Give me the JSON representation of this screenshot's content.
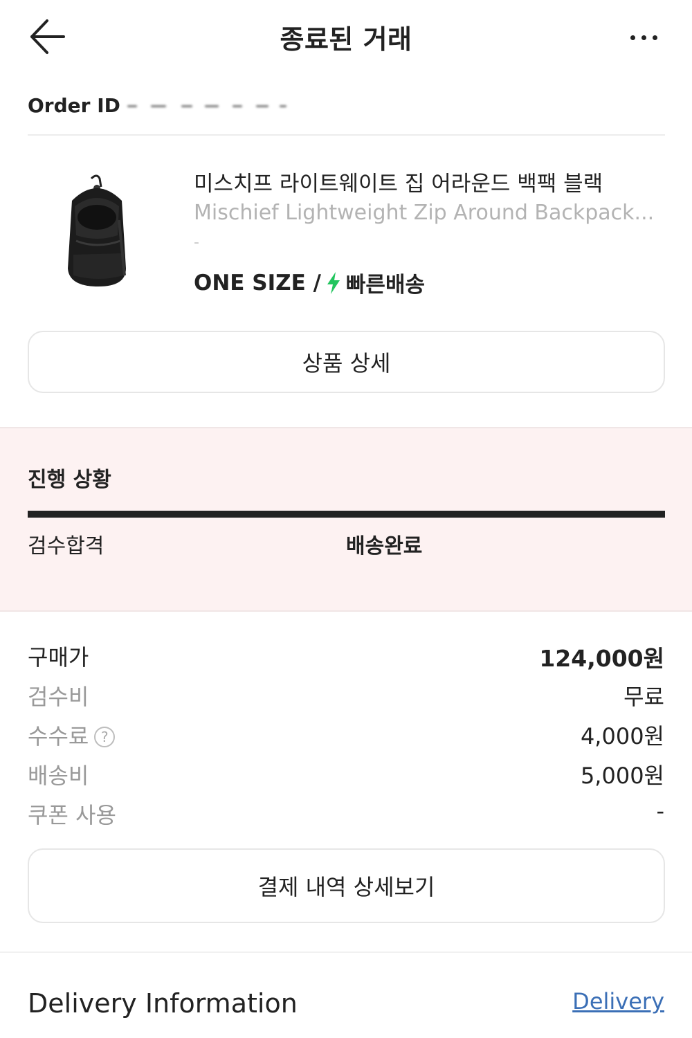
{
  "header": {
    "title": "종료된 거래"
  },
  "order": {
    "id_label": "Order ID"
  },
  "product": {
    "name_ko": "미스치프 라이트웨이트 집 어라운드 백팩 블랙",
    "name_en": "Mischief Lightweight Zip Around Backpack...",
    "dash": "-",
    "size": "ONE SIZE /",
    "shipping_type": "빠른배송",
    "detail_button": "상품 상세",
    "bolt_color": "#22c55e"
  },
  "progress": {
    "title": "진행 상황",
    "steps": [
      "검수합격",
      "배송완료"
    ]
  },
  "prices": {
    "rows": [
      {
        "label": "구매가",
        "value": "124,000원"
      },
      {
        "label": "검수비",
        "value": "무료"
      },
      {
        "label": "수수료",
        "value": "4,000원"
      },
      {
        "label": "배송비",
        "value": "5,000원"
      },
      {
        "label": "쿠폰 사용",
        "value": "-"
      }
    ],
    "help_icon_text": "?",
    "payment_button": "결제 내역 상세보기"
  },
  "delivery": {
    "title": "Delivery Information",
    "link": "Delivery"
  },
  "colors": {
    "progress_background": "#fdf2f2",
    "link": "#3b6fb6"
  }
}
